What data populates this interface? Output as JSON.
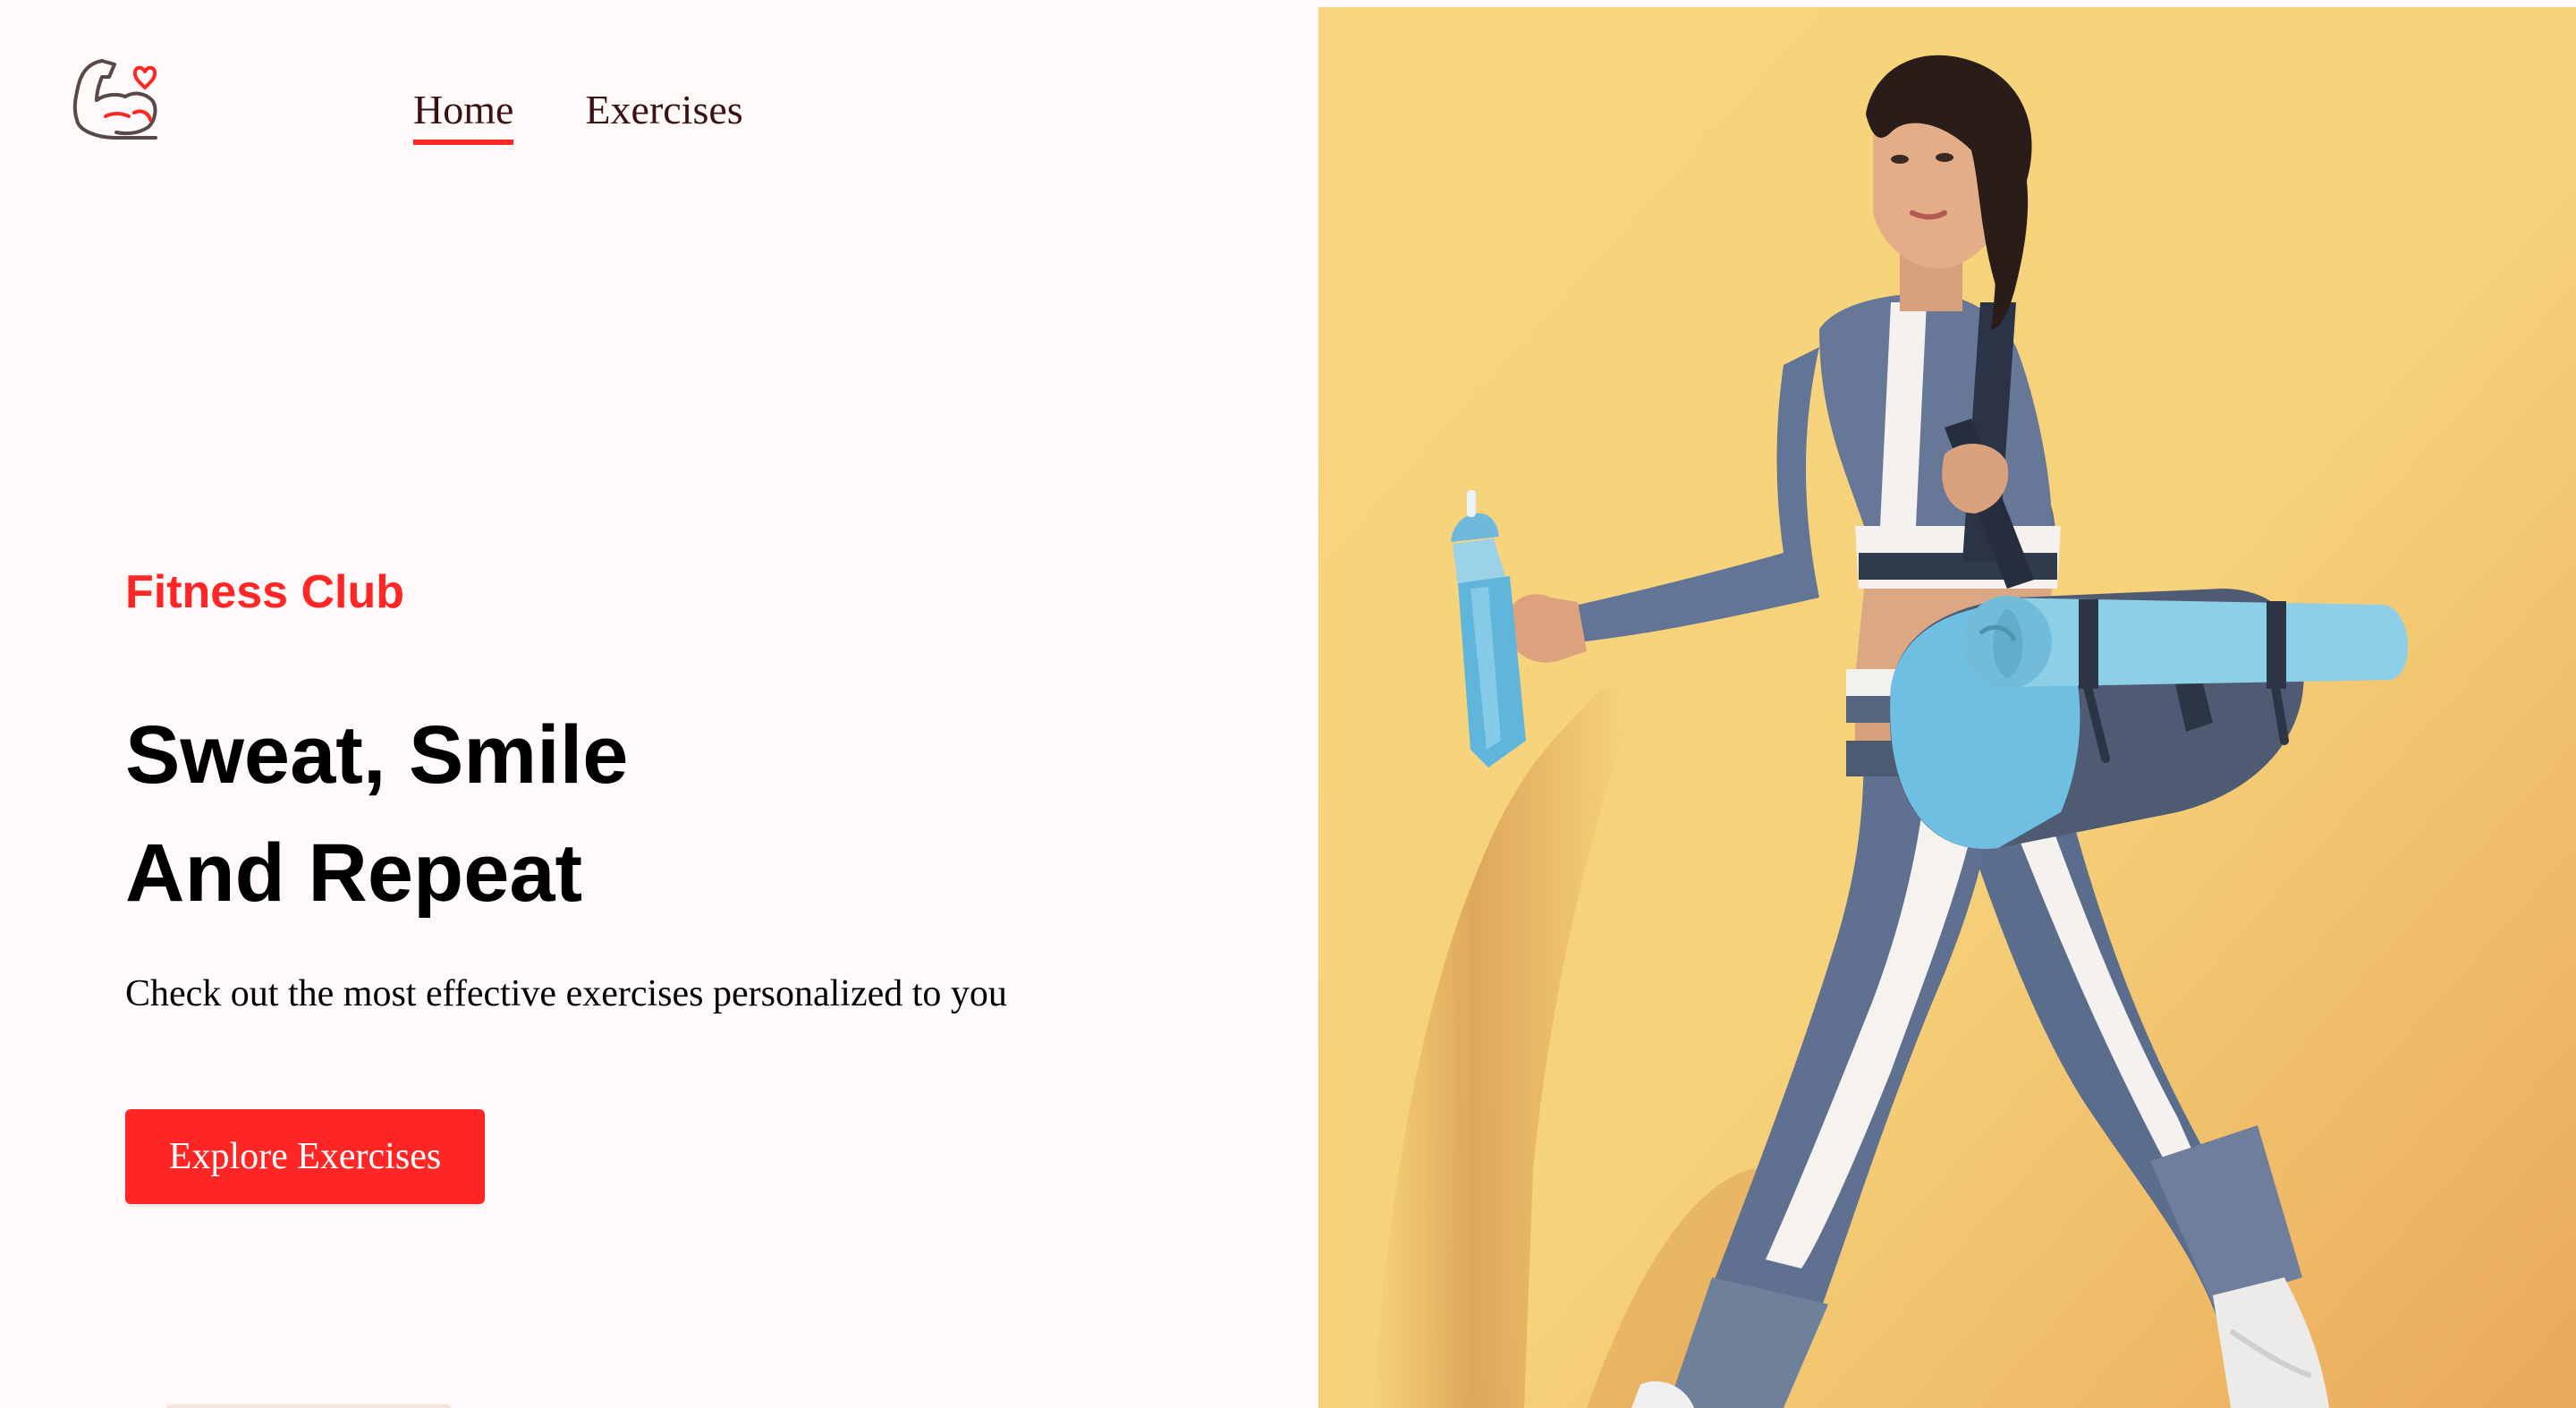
{
  "header": {
    "logo_icon": "flexed-bicep-heart-icon",
    "nav": [
      {
        "label": "Home",
        "active": true
      },
      {
        "label": "Exercises",
        "active": false
      }
    ]
  },
  "hero": {
    "eyebrow": "Fitness Club",
    "headline_line1": "Sweat, Smile",
    "headline_line2": "And Repeat",
    "subtitle": "Check out the most effective exercises personalized to you",
    "cta_label": "Explore Exercises",
    "image_alt": "woman walking with shaker bottle, gym bag and yoga mat"
  },
  "colors": {
    "accent": "#ff2625",
    "background": "#fff9f9",
    "text": "#000000",
    "image_backdrop": "#f7d57e"
  }
}
